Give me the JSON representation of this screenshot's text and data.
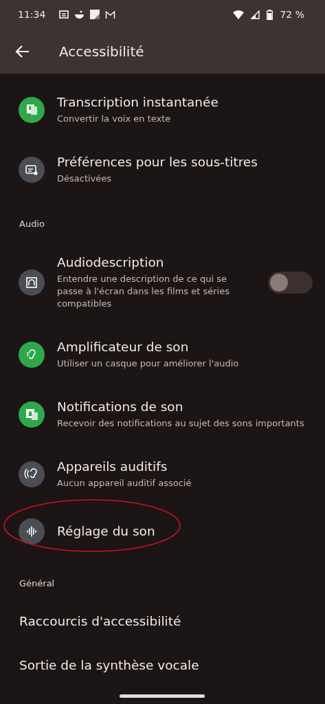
{
  "status_bar": {
    "time": "11:34",
    "battery": "72 %"
  },
  "header": {
    "title": "Accessibilité"
  },
  "sections": [
    {
      "items": [
        {
          "title": "Transcription instantanée",
          "subtitle": "Convertir la voix en texte",
          "color": "#2ea84a"
        },
        {
          "title": "Préférences pour les sous-titres",
          "subtitle": "Désactivées",
          "color": "#4a4d53"
        }
      ]
    },
    {
      "heading": "Audio",
      "items": [
        {
          "title": "Audiodescription",
          "subtitle": "Entendre une description de ce qui se passe à l'écran dans les films et séries compatibles",
          "color": "#4a4d53",
          "toggle": {
            "on": false
          }
        },
        {
          "title": "Amplificateur de son",
          "subtitle": "Utiliser un casque pour améliorer l'audio",
          "color": "#2ea84a"
        },
        {
          "title": "Notifications de son",
          "subtitle": "Recevoir des notifications au sujet des sons importants",
          "color": "#2ea84a"
        },
        {
          "title": "Appareils auditifs",
          "subtitle": "Aucun appareil auditif associé",
          "color": "#4a4d53"
        },
        {
          "title": "Réglage du son",
          "color": "#4a4d53",
          "highlighted": true
        }
      ]
    },
    {
      "heading": "Général",
      "items": [
        {
          "title": "Raccourcis d'accessibilité"
        },
        {
          "title": "Sortie de la synthèse vocale"
        }
      ]
    }
  ]
}
